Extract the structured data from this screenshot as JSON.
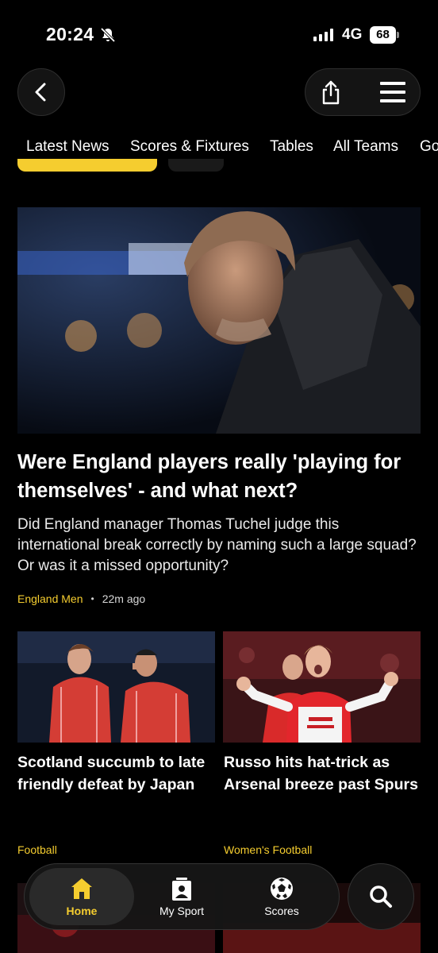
{
  "status_bar": {
    "time": "20:24",
    "network": "4G",
    "battery": "68"
  },
  "tabs": [
    {
      "label": "Latest News"
    },
    {
      "label": "Scores & Fixtures"
    },
    {
      "label": "Tables"
    },
    {
      "label": "All Teams"
    },
    {
      "label": "Go"
    }
  ],
  "hero": {
    "title": "Were England players really 'playing for themselves' - and what next?",
    "summary": "Did England manager Thomas Tuchel judge this international break correctly by naming such a large squad? Or was it a missed opportunity?",
    "tag": "England Men",
    "time_ago": "22m ago"
  },
  "cards": [
    {
      "title": "Scotland succumb to late friendly defeat by Japan",
      "tag": "Football"
    },
    {
      "title": "Russo hits hat-trick as Arsenal breeze past Spurs",
      "tag": "Women's Football"
    }
  ],
  "bottom_nav": {
    "items": [
      {
        "label": "Home",
        "icon": "home-icon"
      },
      {
        "label": "My Sport",
        "icon": "my-sport-icon"
      },
      {
        "label": "Scores",
        "icon": "football-icon"
      }
    ],
    "search_icon": "search-icon"
  },
  "colors": {
    "accent": "#f5cd2f",
    "background": "#000000"
  }
}
